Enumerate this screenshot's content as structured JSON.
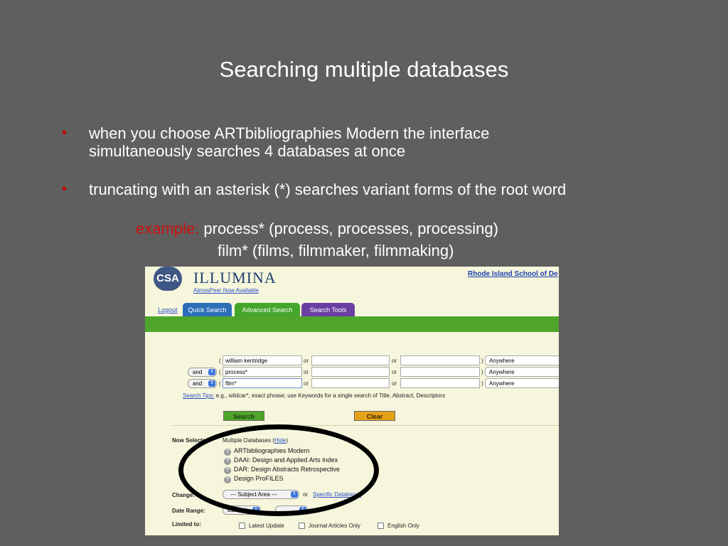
{
  "slide": {
    "title": "Searching multiple databases",
    "bullets": [
      {
        "line1": "when you choose ARTbibliographies Modern the interface",
        "line2": "simultaneously searches 4 databases at once"
      },
      {
        "line1": "truncating with an asterisk (*) searches variant forms of the root word"
      }
    ],
    "bullet_symbol": "•",
    "example_label": "example:",
    "example_line1": "process* (process, processes, processing)",
    "example_line2": "film* (films, filmmaker, filmmaking)"
  },
  "app": {
    "logo": "CSA",
    "brand": "ILLUMINA",
    "atmos_link": "AtmosPeer Now Available",
    "institution_link": "Rhode Island School of De",
    "logout": "Logout",
    "tabs": [
      "Quick Search",
      "Advanced Search",
      "Search Tools"
    ],
    "active_tab": "Advanced Search",
    "search_rows": [
      {
        "operator": "",
        "term1": "william kentridge",
        "term2": "",
        "term3": "",
        "field": "Anywhere"
      },
      {
        "operator": "and",
        "term1": "process*",
        "term2": "",
        "term3": "",
        "field": "Anywhere"
      },
      {
        "operator": "and",
        "term1": "film*",
        "term2": "",
        "term3": "",
        "field": "Anywhere"
      }
    ],
    "open_paren": "(",
    "close_paren": ")",
    "or_label": "or",
    "tips_link": "Search Tips:",
    "tips_text": "e.g., wildcar*, exact phrase; use Keywords for a single search of Title, Abstract, Descriptors",
    "search_button": "Search",
    "clear_button": "Clear",
    "now_selected_label": "Now Selected:",
    "multiple_db_text": "Multiple Databases (",
    "hide_link": "Hide",
    "multiple_db_close": ")",
    "databases": [
      "ARTbibliographies Modern",
      "DAAI: Design and Applied Arts Index",
      "DAR: Design Abstracts Retrospective",
      "Design ProFILES"
    ],
    "help_icon_glyph": "?",
    "change_label": "Change:",
    "subject_area": "--- Subject Area ---",
    "change_or": "or",
    "specific_databases": "Specific Databases",
    "date_range_label": "Date Range:",
    "date_from": "Earliest",
    "limited_to_label": "Limited to:",
    "limits": [
      "Latest Update",
      "Journal Articles Only",
      "English Only"
    ],
    "select_arrow_glyph": "⇕"
  },
  "colors": {
    "background": "#5f5f5f",
    "bullet": "#cc0000",
    "example_label": "#cc1111",
    "app_green": "#4ea52a",
    "annotation_circle": "#000000"
  },
  "icons": [
    "help-icon",
    "select-arrow-icon"
  ]
}
